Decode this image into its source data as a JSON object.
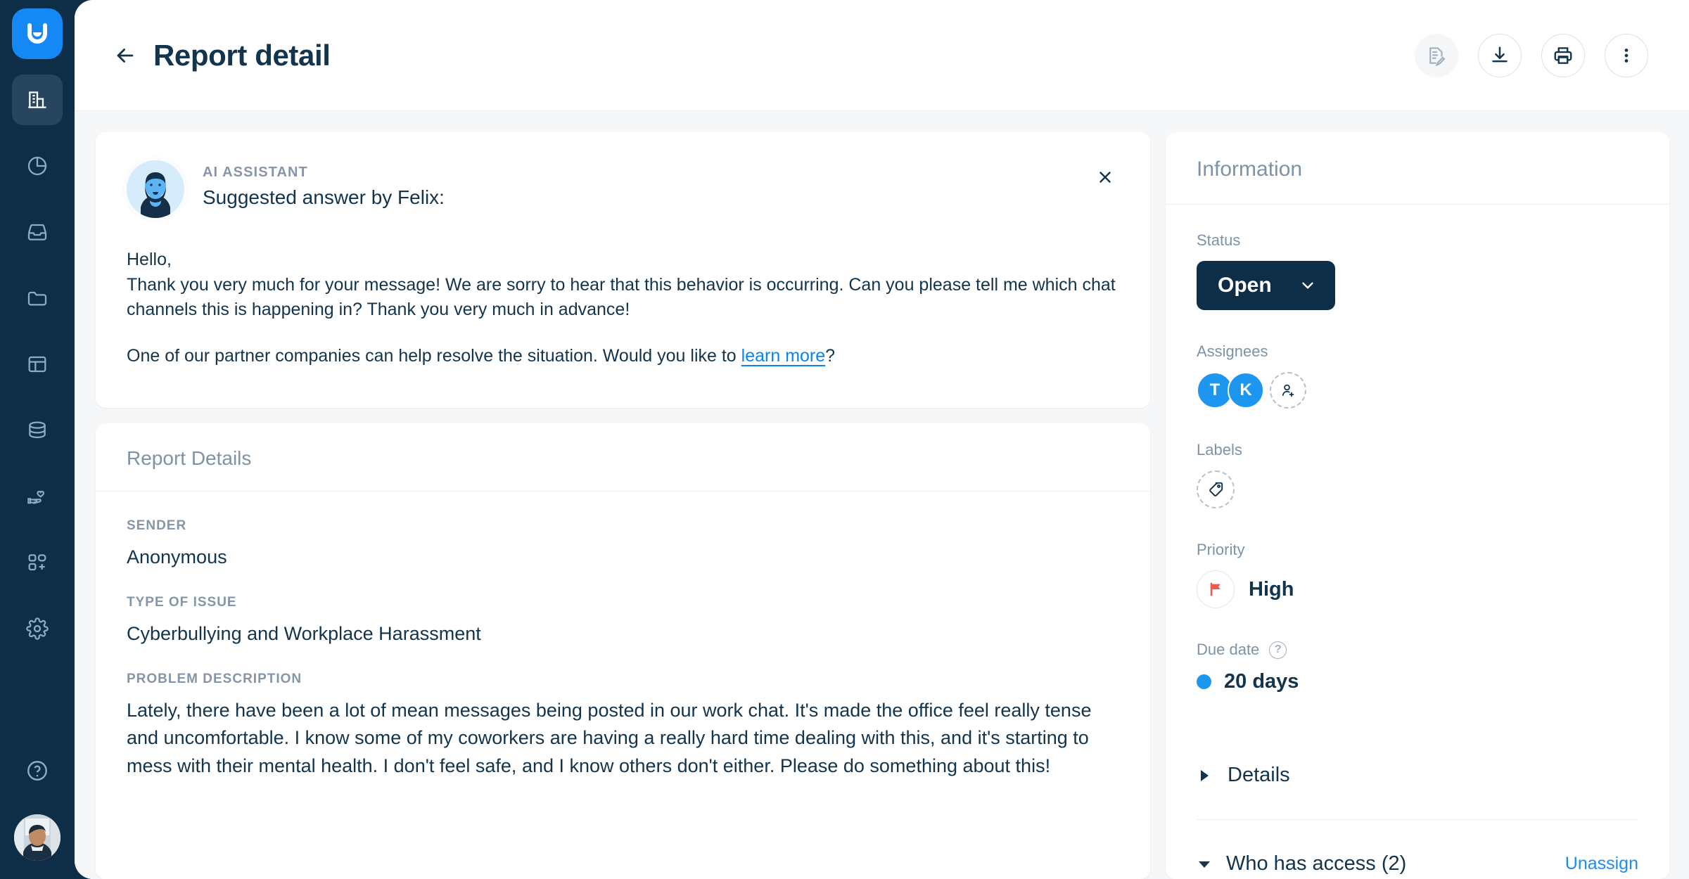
{
  "app": {
    "logo_icon": "smile-logo-icon",
    "background": "#f5f7f9",
    "brand_color": "#1488f5",
    "navy": "#0e2d47"
  },
  "sidebar": {
    "items": [
      {
        "icon": "building-reports-icon",
        "name": "sidebar-item-reports",
        "active": true
      },
      {
        "icon": "pie-chart-icon",
        "name": "sidebar-item-analytics",
        "active": false
      },
      {
        "icon": "inbox-icon",
        "name": "sidebar-item-inbox",
        "active": false
      },
      {
        "icon": "folder-icon",
        "name": "sidebar-item-files",
        "active": false
      },
      {
        "icon": "layout-icon",
        "name": "sidebar-item-board",
        "active": false
      },
      {
        "icon": "database-icon",
        "name": "sidebar-item-database",
        "active": false
      },
      {
        "icon": "hand-heart-icon",
        "name": "sidebar-item-care",
        "active": false
      },
      {
        "icon": "apps-add-icon",
        "name": "sidebar-item-integrations",
        "active": false
      },
      {
        "icon": "gear-icon",
        "name": "sidebar-item-settings",
        "active": false
      }
    ],
    "help_icon": "question-circle-icon",
    "user_avatar": "user-photo-avatar"
  },
  "header": {
    "back_icon": "arrow-left-icon",
    "title": "Report detail",
    "actions": [
      {
        "icon": "ai-summarize-icon",
        "name": "ai-summarize-button",
        "disabled": true
      },
      {
        "icon": "download-icon",
        "name": "download-button",
        "disabled": false
      },
      {
        "icon": "print-icon",
        "name": "print-button",
        "disabled": false
      },
      {
        "icon": "more-vertical-icon",
        "name": "more-options-button",
        "disabled": false
      }
    ]
  },
  "ai_card": {
    "kicker": "AI ASSISTANT",
    "subject": "Suggested answer by Felix:",
    "close_icon": "close-icon",
    "avatar_icon": "ai-assistant-avatar",
    "greeting": "Hello,",
    "paragraph1": "Thank you very much for your message! We are sorry to hear that this behavior is occurring. Can you please tell me which chat channels this is happening in? Thank you very much in advance!",
    "paragraph2_before": "One of our partner companies can help resolve the situation. Would you like to ",
    "link_text": "learn more",
    "paragraph2_after": "?"
  },
  "report_details": {
    "title": "Report Details",
    "fields": [
      {
        "label": "SENDER",
        "value": "Anonymous"
      },
      {
        "label": "TYPE OF ISSUE",
        "value": "Cyberbullying and Workplace Harassment"
      },
      {
        "label": "PROBLEM DESCRIPTION",
        "value": "Lately, there have been a lot of mean messages being posted in our work chat. It's made the office feel really tense and uncomfortable. I know some of my coworkers are having a really hard time dealing with this, and it's starting to mess with their mental health. I don't feel safe, and I know others don't either. Please do something about this!"
      }
    ]
  },
  "information": {
    "title": "Information",
    "status": {
      "label": "Status",
      "value": "Open",
      "chevron_icon": "chevron-down-icon"
    },
    "assignees": {
      "label": "Assignees",
      "people": [
        {
          "initial": "T"
        },
        {
          "initial": "K"
        }
      ],
      "add_icon": "add-person-icon"
    },
    "labels": {
      "label": "Labels",
      "add_icon": "tag-icon"
    },
    "priority": {
      "label": "Priority",
      "value": "High",
      "icon": "red-flag-icon",
      "color": "#f4564a"
    },
    "due_date": {
      "label": "Due date",
      "help_icon": "help-circle-icon",
      "value": "20 days",
      "dot_color": "#1d96f0"
    },
    "details": {
      "label": "Details",
      "chevron_icon": "chevron-right-icon"
    },
    "access": {
      "label": "Who has access (2)",
      "chevron_icon": "chevron-down-icon",
      "link": "Unassign"
    }
  }
}
